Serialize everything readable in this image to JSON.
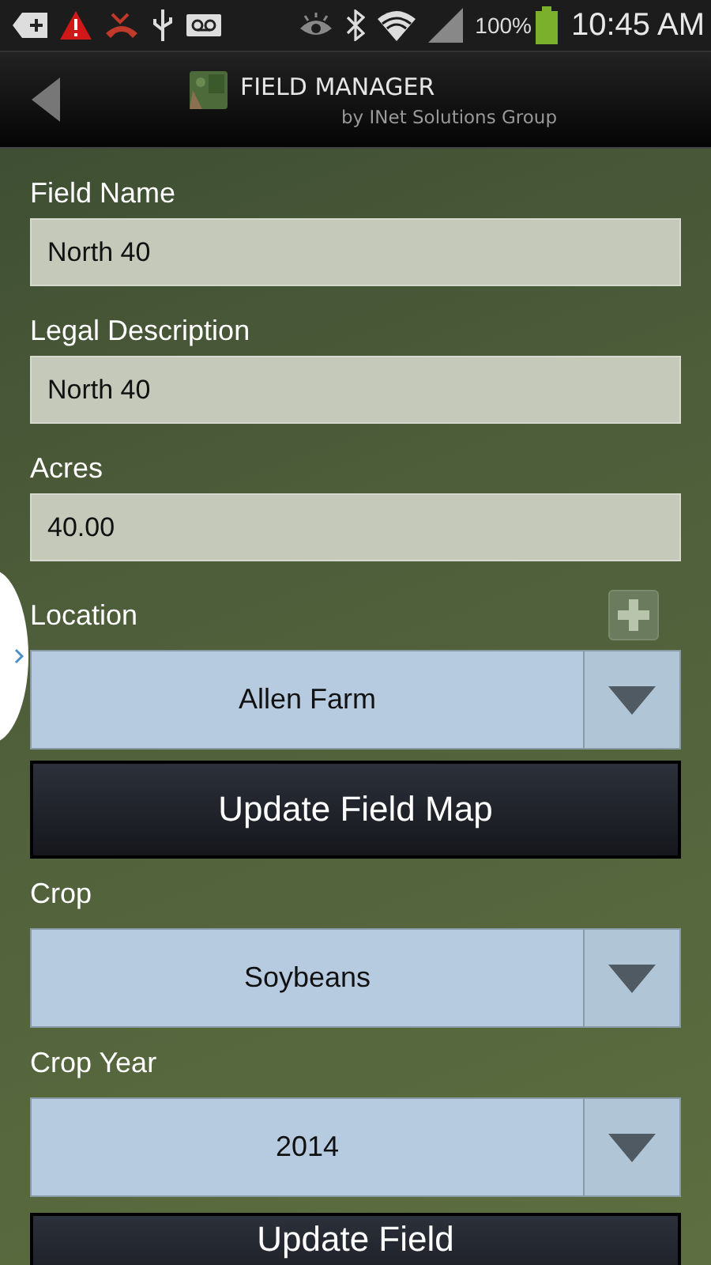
{
  "status_bar": {
    "battery": "100%",
    "time": "10:45 AM"
  },
  "header": {
    "title": "FIELD MANAGER",
    "subtitle": "by INet Solutions Group"
  },
  "form": [
    {
      "kind": "text",
      "label": "Field Name",
      "value": "North 40"
    },
    {
      "kind": "text",
      "label": "Legal Description",
      "value": "North 40"
    },
    {
      "kind": "text",
      "label": "Acres",
      "value": "40.00"
    },
    {
      "kind": "select",
      "label": "Location",
      "value": "Allen Farm",
      "addable": true
    },
    {
      "kind": "button",
      "label": "Update Field Map"
    },
    {
      "kind": "select",
      "label": "Crop",
      "value": "Soybeans",
      "addable": false
    },
    {
      "kind": "select",
      "label": "Crop Year",
      "value": "2014",
      "addable": false
    },
    {
      "kind": "button",
      "label": "Update Field"
    }
  ]
}
